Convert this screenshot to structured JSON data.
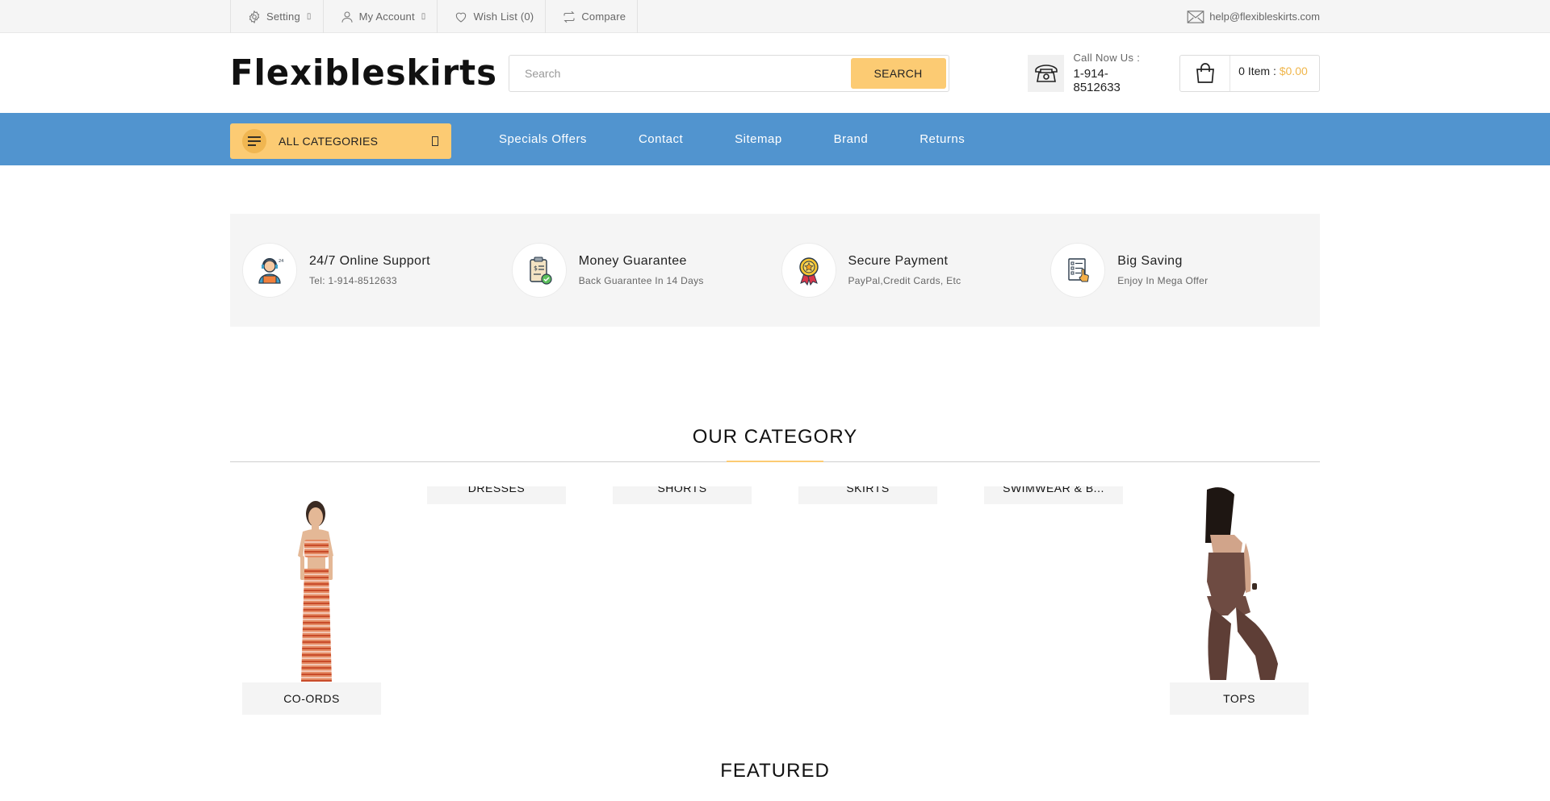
{
  "topbar": {
    "setting": "Setting",
    "account": "My Account",
    "wishlist": "Wish List (0)",
    "compare": "Compare",
    "email": "help@flexibleskirts.com"
  },
  "header": {
    "logo": "Flexibleskirts",
    "search_placeholder": "Search",
    "search_button": "SEARCH",
    "call_label": "Call Now Us :",
    "call_number": "1-914-8512633",
    "cart_items": "0 Item :",
    "cart_amount": "$0.00"
  },
  "nav": {
    "all_categories": "ALL CATEGORIES",
    "links": [
      "Specials Offers",
      "Contact",
      "Sitemap",
      "Brand",
      "Returns"
    ]
  },
  "features": [
    {
      "title": "24/7 Online Support",
      "subtitle": "Tel: 1-914-8512633",
      "icon": "support-agent-icon"
    },
    {
      "title": "Money Guarantee",
      "subtitle": "Back Guarantee In 14 Days",
      "icon": "money-guarantee-icon"
    },
    {
      "title": "Secure Payment",
      "subtitle": "PayPal,Credit Cards, Etc",
      "icon": "award-medal-icon"
    },
    {
      "title": "Big Saving",
      "subtitle": "Enjoy In Mega Offer",
      "icon": "checklist-icon"
    }
  ],
  "category": {
    "title": "OUR CATEGORY",
    "items": [
      "CO-ORDS",
      "DRESSES",
      "SHORTS",
      "SKIRTS",
      "SWIMWEAR & B...",
      "TOPS"
    ]
  },
  "featured": {
    "title": "FEATURED"
  },
  "colors": {
    "accent": "#fccb73",
    "nav_bg": "#5194cf",
    "price": "#f0b64b"
  }
}
